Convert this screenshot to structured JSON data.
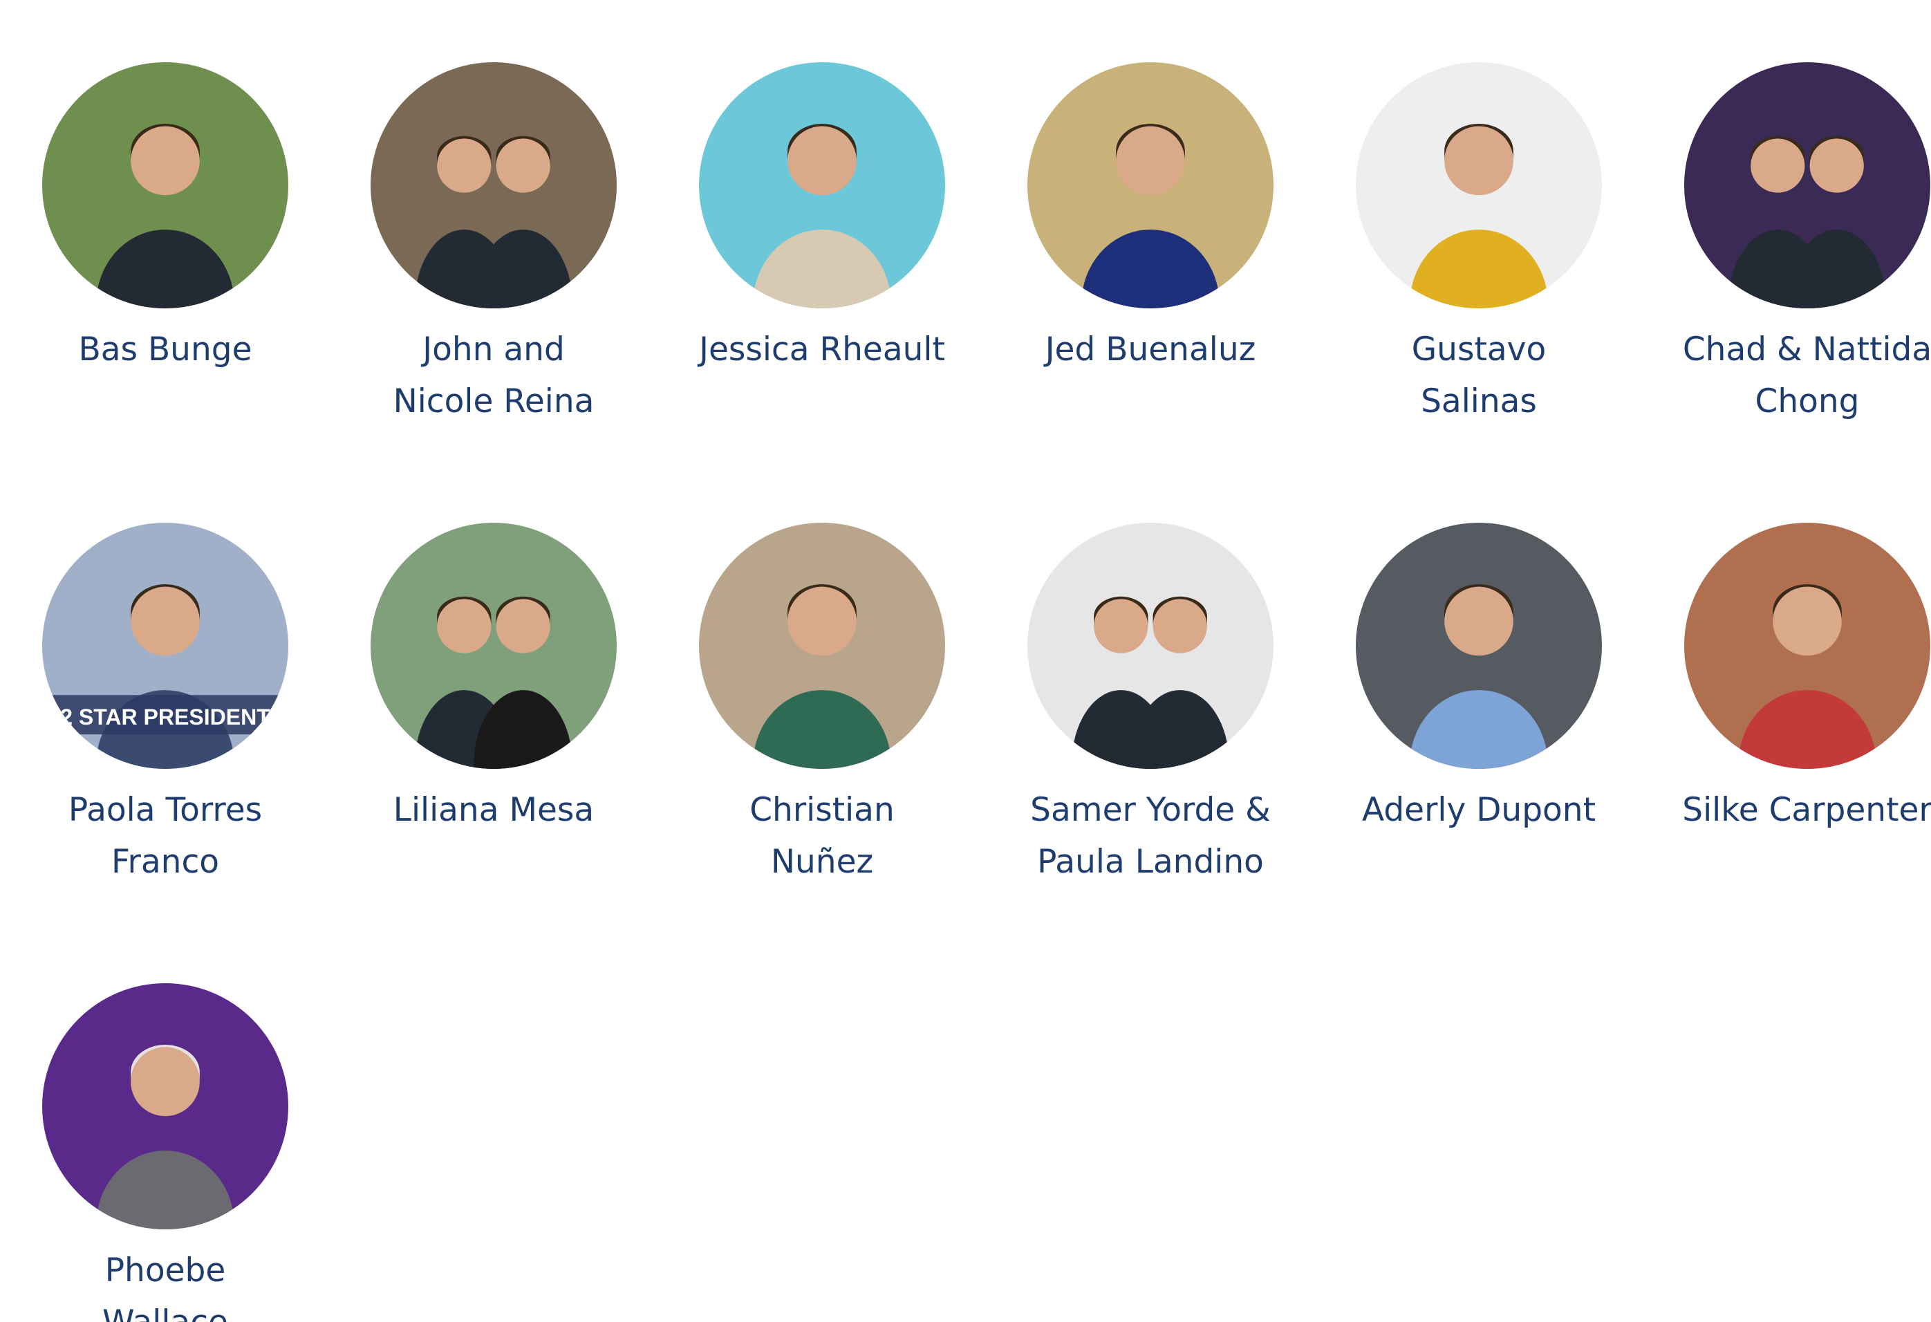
{
  "leaders": [
    {
      "name_line1": "Bas Bunge",
      "name_line2": "",
      "photo": "man-outdoors-icon",
      "bg": "#6f8f4e"
    },
    {
      "name_line1": "John and",
      "name_line2": "Nicole Reina",
      "photo": "couple-selfie-icon",
      "bg": "#7a6a55"
    },
    {
      "name_line1": "Jessica Rheault",
      "name_line2": "",
      "photo": "woman-beach-icon",
      "bg": "#6cc8d8"
    },
    {
      "name_line1": "Jed Buenaluz",
      "name_line2": "",
      "photo": "man-suit-icon",
      "bg": "#c8b27a"
    },
    {
      "name_line1": "Gustavo",
      "name_line2": "Salinas",
      "photo": "man-yellow-jacket-icon",
      "bg": "#eeeeee"
    },
    {
      "name_line1": "Chad & Nattida",
      "name_line2": "Chong",
      "photo": "couple-stage-icon",
      "bg": "#3a2a55"
    },
    {
      "name_line1": "Paola Torres",
      "name_line2": "Franco",
      "photo": "promo-poster-icon",
      "bg": "#9fb0c8",
      "poster_text": "2 STAR PRESIDENT"
    },
    {
      "name_line1": "Liliana Mesa",
      "name_line2": "",
      "photo": "couple-outdoors-icon",
      "bg": "#7fa07a"
    },
    {
      "name_line1": "Christian",
      "name_line2": "Nuñez",
      "photo": "man-green-suit-icon",
      "bg": "#b9a48c"
    },
    {
      "name_line1": "Samer Yorde &",
      "name_line2": "Paula Landino",
      "photo": "couple-studio-icon",
      "bg": "#e6e6e6"
    },
    {
      "name_line1": "Aderly Dupont",
      "name_line2": "",
      "photo": "man-blue-shirt-icon",
      "bg": "#555b60"
    },
    {
      "name_line1": "Silke Carpenter",
      "name_line2": "",
      "photo": "woman-car-icon",
      "bg": "#b07050"
    },
    {
      "name_line1": "Phoebe",
      "name_line2": "Wallace",
      "photo": "woman-purple-light-icon",
      "bg": "#5a2a8a"
    }
  ],
  "colors": {
    "name_text": "#1f3c6e",
    "background": "#ffffff"
  }
}
